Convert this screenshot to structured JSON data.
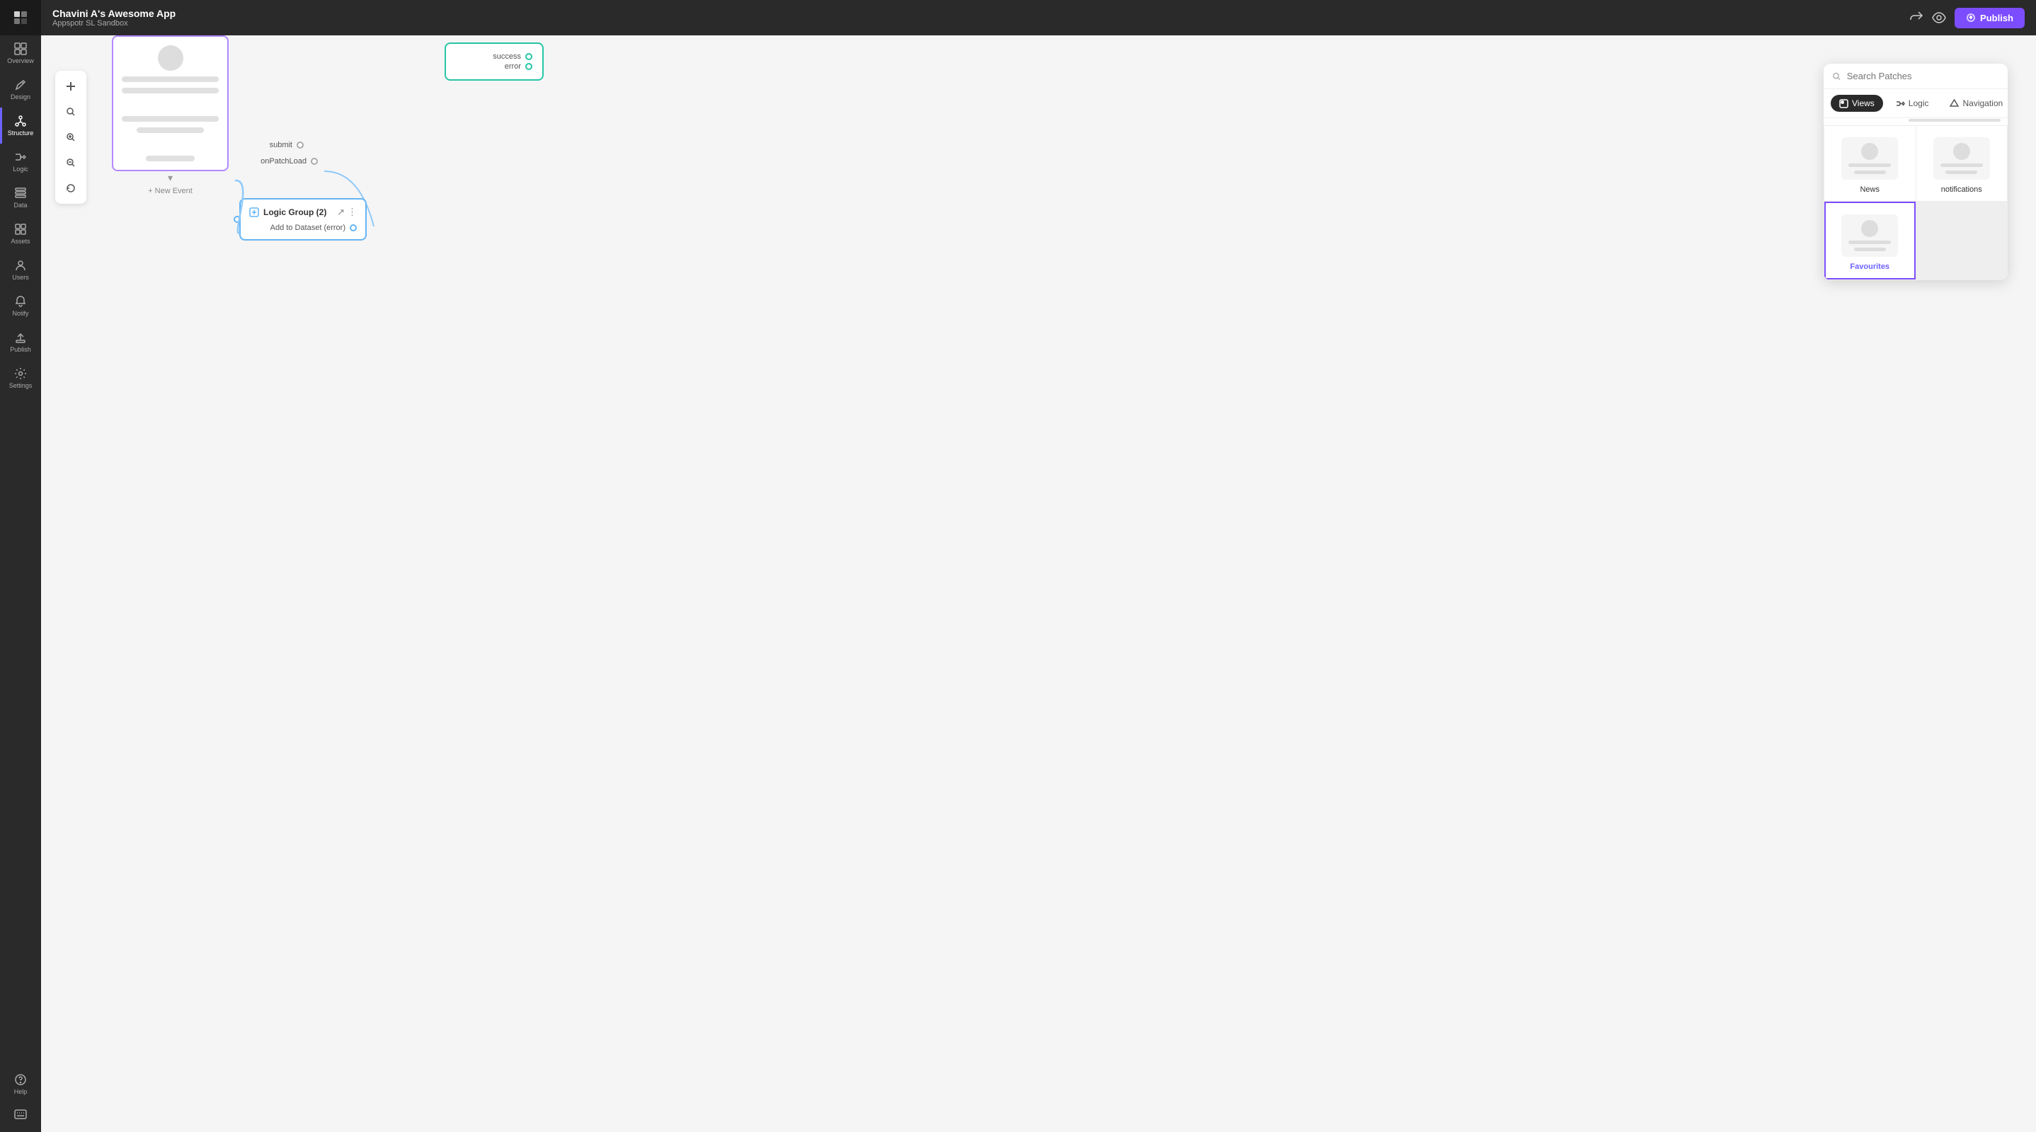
{
  "app": {
    "name": "Chavini A's Awesome App",
    "subtitle": "Appspotr SL Sandbox"
  },
  "topbar": {
    "publish_label": "Publish",
    "share_icon": "⬆",
    "preview_icon": "👁"
  },
  "sidebar": {
    "items": [
      {
        "id": "home",
        "icon": "⌂",
        "label": "Overview"
      },
      {
        "id": "design",
        "icon": "✏",
        "label": "Design"
      },
      {
        "id": "structure",
        "icon": "⊞",
        "label": "Structure",
        "active": true
      },
      {
        "id": "logic",
        "icon": "⚡",
        "label": "Logic"
      },
      {
        "id": "data",
        "icon": "▤",
        "label": "Data"
      },
      {
        "id": "assets",
        "icon": "◫",
        "label": "Assets"
      },
      {
        "id": "users",
        "icon": "👤",
        "label": "Users"
      },
      {
        "id": "notify",
        "icon": "🔔",
        "label": "Notify"
      },
      {
        "id": "publish",
        "icon": "⬆",
        "label": "Publish"
      },
      {
        "id": "settings",
        "icon": "⚙",
        "label": "Settings"
      }
    ],
    "bottom": {
      "help_icon": "?",
      "help_label": "Help",
      "keyboard_icon": "⌨"
    }
  },
  "canvas_toolbar": {
    "tools": [
      {
        "id": "add",
        "icon": "+"
      },
      {
        "id": "search",
        "icon": "🔍"
      },
      {
        "id": "zoom-in",
        "icon": "🔎"
      },
      {
        "id": "zoom-out",
        "icon": "🔍"
      },
      {
        "id": "refresh",
        "icon": "↺"
      }
    ]
  },
  "nodes": {
    "screen_node": {
      "events": {
        "submit": "submit",
        "on_patch_load": "onPatchLoad"
      },
      "new_event_label": "+ New Event",
      "chevron": "▾"
    },
    "api_node": {
      "outputs": [
        "success",
        "error"
      ]
    },
    "logic_group_node": {
      "title": "Logic Group (2)",
      "port_label": "Add to Dataset (error)"
    }
  },
  "patches_panel": {
    "search_placeholder": "Search Patches",
    "tabs": [
      {
        "id": "views",
        "label": "Views",
        "active": true
      },
      {
        "id": "logic",
        "label": "Logic",
        "active": false
      },
      {
        "id": "navigation",
        "label": "Navigation",
        "active": false
      }
    ],
    "items": [
      {
        "id": "news",
        "label": "News",
        "selected": false
      },
      {
        "id": "notifications",
        "label": "notifications",
        "selected": false
      },
      {
        "id": "favourites",
        "label": "Favourites",
        "selected": true
      }
    ]
  }
}
